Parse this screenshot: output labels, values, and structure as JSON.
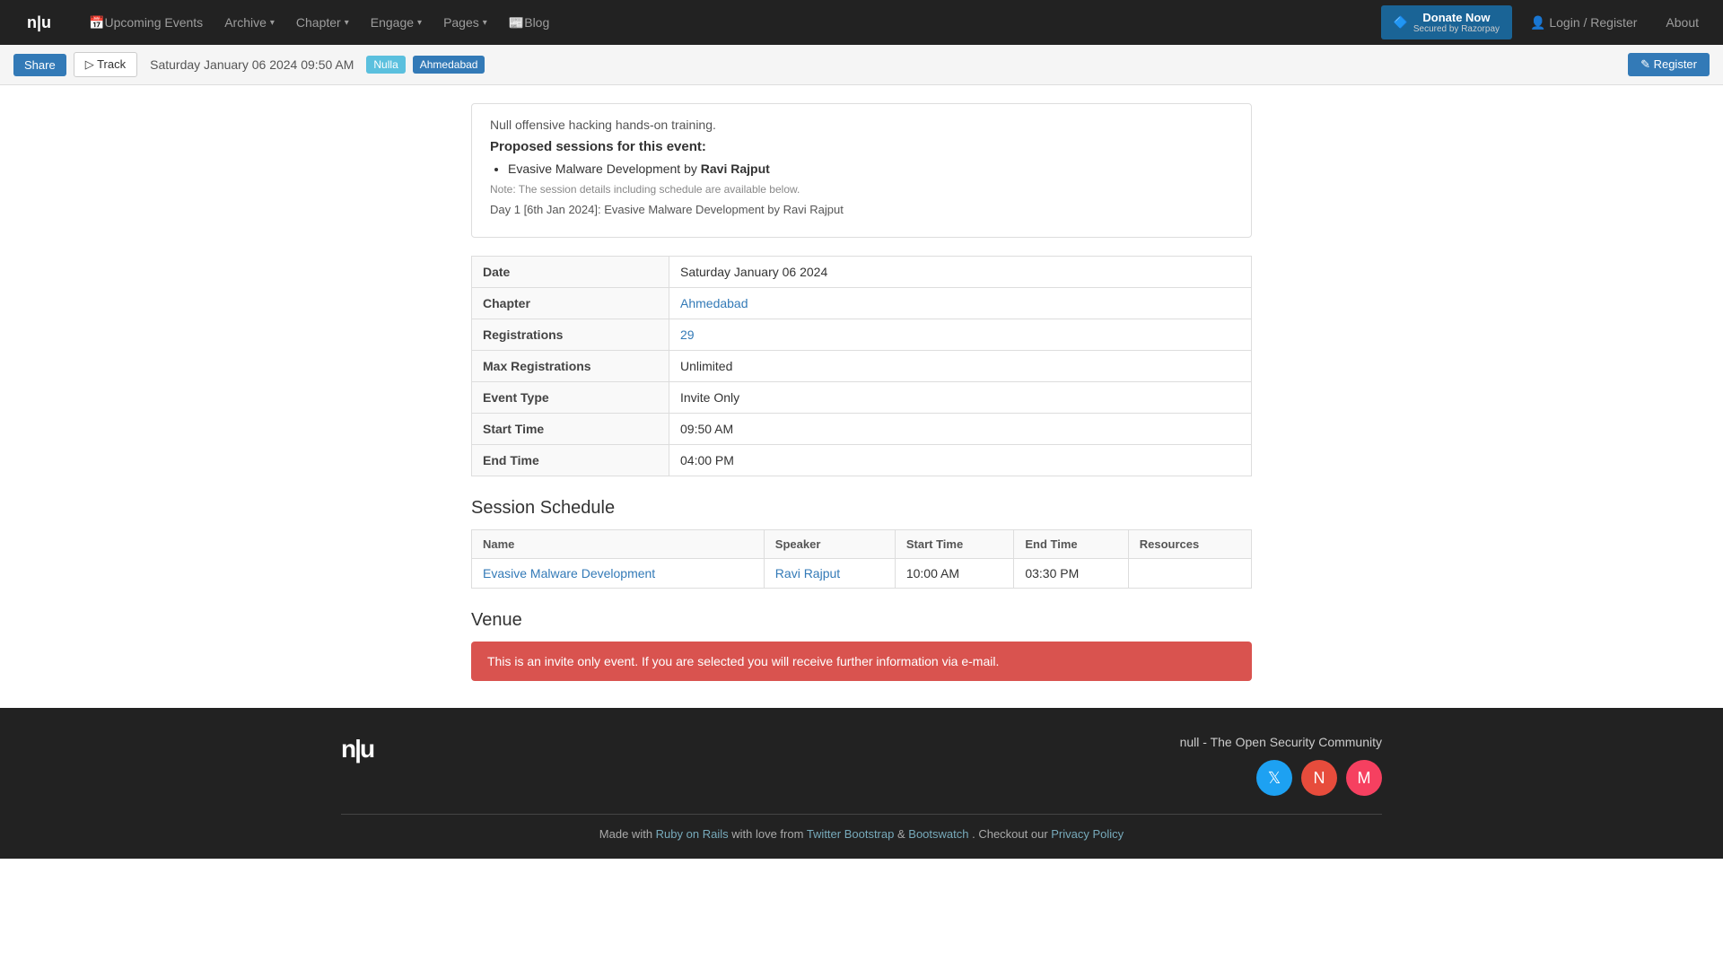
{
  "navbar": {
    "brand": "n|u",
    "links": [
      {
        "label": "Upcoming Events",
        "icon": "calendar-icon",
        "dropdown": false
      },
      {
        "label": "Archive",
        "dropdown": true
      },
      {
        "label": "Chapter",
        "dropdown": true
      },
      {
        "label": "Engage",
        "dropdown": true
      },
      {
        "label": "Pages",
        "dropdown": true
      },
      {
        "label": "Blog",
        "icon": "rss-icon",
        "dropdown": false
      }
    ],
    "donate": {
      "label": "Donate Now",
      "sublabel": "Secured by Razorpay"
    },
    "login": "Login / Register",
    "about": "About"
  },
  "event_header": {
    "share": "Share",
    "track": "Track",
    "date": "Saturday January 06 2024 09:50 AM",
    "tag_null": "Nulla",
    "tag_location": "Ahmedabad",
    "register": "Register"
  },
  "event_info": {
    "description": "Null offensive hacking hands-on training.",
    "sessions_title": "Proposed sessions for this event:",
    "sessions": [
      {
        "name": "Evasive Malware Development",
        "speaker": "Ravi Rajput"
      }
    ],
    "note": "Note: The session details including schedule are available below.",
    "day_line": "Day 1 [6th Jan 2024]: Evasive Malware Development by Ravi Rajput"
  },
  "details": {
    "rows": [
      {
        "label": "Date",
        "value": "Saturday January 06 2024",
        "link": false
      },
      {
        "label": "Chapter",
        "value": "Ahmedabad",
        "link": true
      },
      {
        "label": "Registrations",
        "value": "29",
        "link": true
      },
      {
        "label": "Max Registrations",
        "value": "Unlimited",
        "link": false
      },
      {
        "label": "Event Type",
        "value": "Invite Only",
        "link": false
      },
      {
        "label": "Start Time",
        "value": "09:50 AM",
        "link": false
      },
      {
        "label": "End Time",
        "value": "04:00 PM",
        "link": false
      }
    ]
  },
  "schedule": {
    "title": "Session Schedule",
    "columns": [
      "Name",
      "Speaker",
      "Start Time",
      "End Time",
      "Resources"
    ],
    "rows": [
      {
        "name": "Evasive Malware Development",
        "name_link": true,
        "speaker": "Ravi Rajput",
        "speaker_link": true,
        "start_time": "10:00 AM",
        "end_time": "03:30 PM",
        "resources": ""
      }
    ]
  },
  "venue": {
    "title": "Venue",
    "invite_notice": "This is an invite only event. If you are selected you will receive further information via e-mail."
  },
  "footer": {
    "logo": "n|u",
    "org_name": "null - The Open Security Community",
    "social": [
      {
        "name": "twitter",
        "label": "T"
      },
      {
        "name": "null-site",
        "label": "N"
      },
      {
        "name": "meetup",
        "label": "M"
      }
    ],
    "made_with": "Made with ",
    "ruby_on_rails": "Ruby on Rails",
    "love": " with love from ",
    "twitter_bootstrap": "Twitter Bootstrap",
    "and": " & ",
    "bootswatch": "Bootswatch",
    "checkout": ". Checkout our ",
    "privacy_policy": "Privacy Policy"
  }
}
